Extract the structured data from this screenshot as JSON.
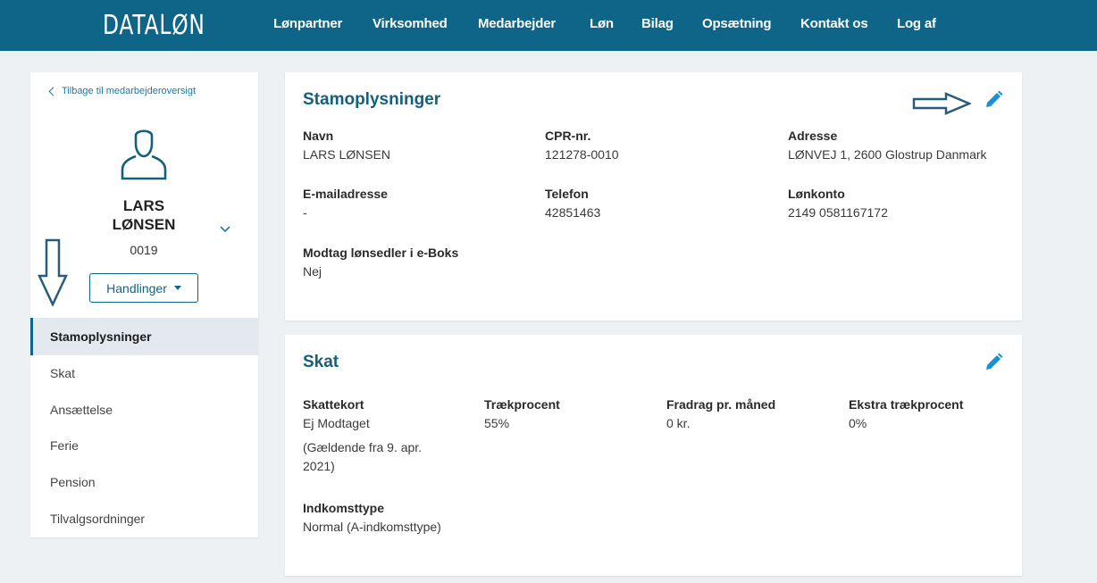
{
  "header": {
    "logo": "DATALØN",
    "nav": [
      {
        "label": "Lønpartner"
      },
      {
        "label": "Virksomhed"
      },
      {
        "label": "Medarbejder"
      },
      {
        "label": "Løn"
      },
      {
        "label": "Bilag"
      },
      {
        "label": "Opsætning"
      },
      {
        "label": "Kontakt os"
      },
      {
        "label": "Log af"
      }
    ]
  },
  "sidebar": {
    "back_link": "Tilbage til medarbejderoversigt",
    "employee": {
      "first_name": "LARS",
      "last_name": "LØNSEN",
      "number": "0019"
    },
    "actions_label": "Handlinger",
    "menu": [
      {
        "label": "Stamoplysninger",
        "active": true
      },
      {
        "label": "Skat"
      },
      {
        "label": "Ansættelse"
      },
      {
        "label": "Ferie"
      },
      {
        "label": "Pension"
      },
      {
        "label": "Tilvalgsordninger"
      }
    ]
  },
  "stamoplysninger": {
    "title": "Stamoplysninger",
    "fields": {
      "navn": {
        "label": "Navn",
        "value": "LARS LØNSEN"
      },
      "cpr": {
        "label": "CPR-nr.",
        "value": "121278-0010"
      },
      "adresse": {
        "label": "Adresse",
        "value": "LØNVEJ 1, 2600 Glostrup Danmark"
      },
      "email": {
        "label": "E-mailadresse",
        "value": "-"
      },
      "telefon": {
        "label": "Telefon",
        "value": "42851463"
      },
      "lonkonto": {
        "label": "Lønkonto",
        "value": "2149 0581167172"
      },
      "eboks": {
        "label": "Modtag lønsedler i e-Boks",
        "value": "Nej"
      }
    }
  },
  "skat": {
    "title": "Skat",
    "fields": {
      "skattekort": {
        "label": "Skattekort",
        "value": "Ej Modtaget",
        "note": "(Gældende fra 9. apr. 2021)"
      },
      "traekprocent": {
        "label": "Trækprocent",
        "value": "55%"
      },
      "fradrag": {
        "label": "Fradrag pr. måned",
        "value": "0 kr."
      },
      "ekstra": {
        "label": "Ekstra trækprocent",
        "value": "0%"
      },
      "indkomsttype": {
        "label": "Indkomsttype",
        "value": "Normal (A-indkomsttype)"
      }
    }
  },
  "icons": {
    "edit": "pencil-icon",
    "avatar": "user-outline-icon",
    "expand": "chevron-down-icon",
    "back": "chevron-left-icon",
    "annotation": "outline-arrow-icon"
  },
  "colors": {
    "header_bg": "#0e6587",
    "title": "#155f7e",
    "link": "#1b7aa6",
    "edit_icon": "#1a8fd1",
    "active_menu_bg": "#e3e9ef"
  }
}
